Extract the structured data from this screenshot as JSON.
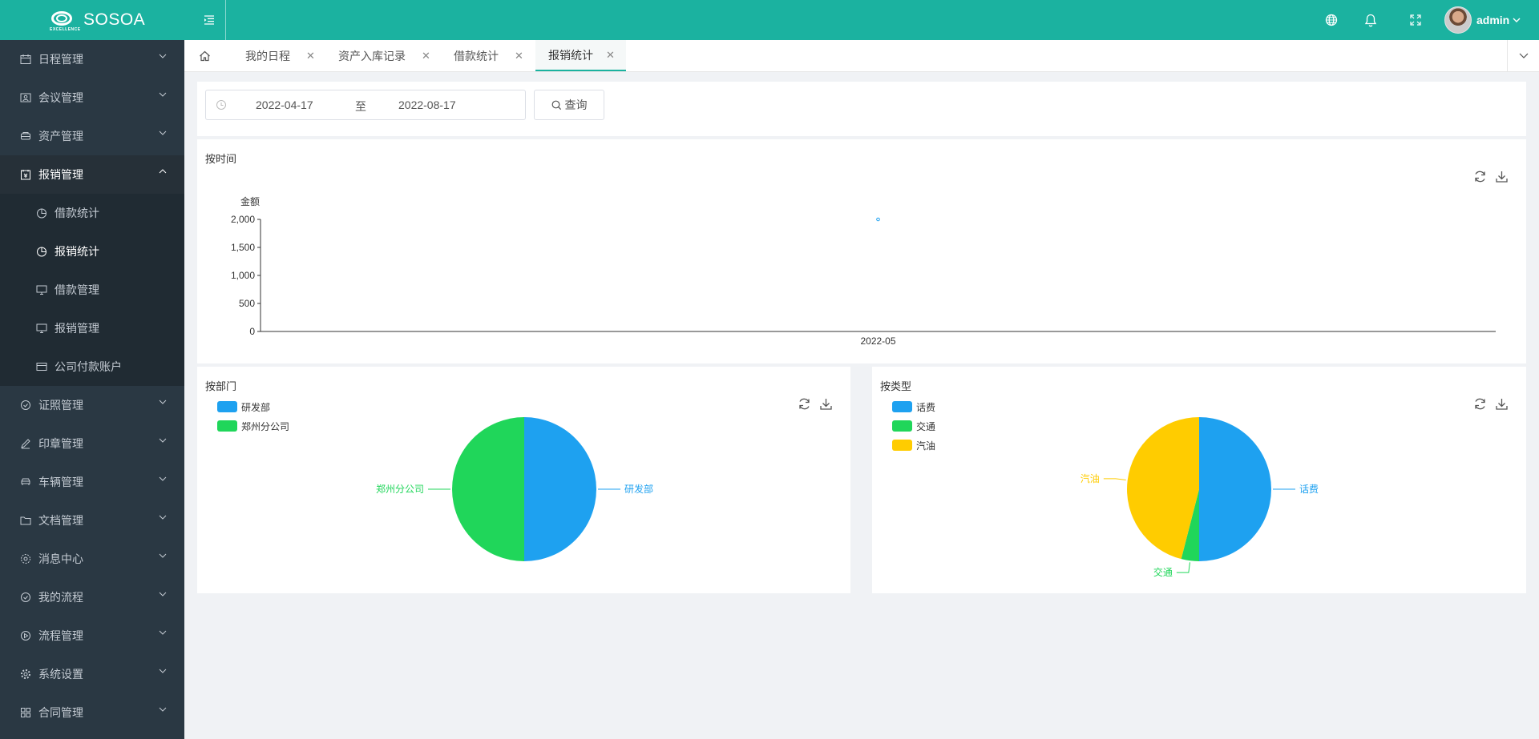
{
  "header": {
    "logo_text": "SOSOA",
    "logo_sub": "EXCELLENCE",
    "username": "admin",
    "icons": [
      "globe-icon",
      "bell-icon",
      "fullscreen-icon"
    ]
  },
  "sidebar": {
    "items": [
      {
        "label": "日程管理",
        "icon": "calendar-icon"
      },
      {
        "label": "会议管理",
        "icon": "meeting-icon"
      },
      {
        "label": "资产管理",
        "icon": "asset-icon"
      },
      {
        "label": "报销管理",
        "icon": "expense-icon",
        "open": true,
        "children": [
          {
            "label": "借款统计",
            "icon": "pie-icon"
          },
          {
            "label": "报销统计",
            "icon": "pie-icon",
            "active": true
          },
          {
            "label": "借款管理",
            "icon": "monitor-icon"
          },
          {
            "label": "报销管理",
            "icon": "monitor-icon"
          },
          {
            "label": "公司付款账户",
            "icon": "card-icon"
          }
        ]
      },
      {
        "label": "证照管理",
        "icon": "check-circle-icon"
      },
      {
        "label": "印章管理",
        "icon": "stamp-icon"
      },
      {
        "label": "车辆管理",
        "icon": "car-icon"
      },
      {
        "label": "文档管理",
        "icon": "folder-icon"
      },
      {
        "label": "消息中心",
        "icon": "settings-icon"
      },
      {
        "label": "我的流程",
        "icon": "check-circle-icon"
      },
      {
        "label": "流程管理",
        "icon": "play-circle-icon"
      },
      {
        "label": "系统设置",
        "icon": "gear-icon"
      },
      {
        "label": "合同管理",
        "icon": "grid-icon"
      }
    ]
  },
  "tabs": [
    {
      "label": "我的日程"
    },
    {
      "label": "资产入库记录"
    },
    {
      "label": "借款统计"
    },
    {
      "label": "报销统计",
      "active": true
    }
  ],
  "filter": {
    "start_date": "2022-04-17",
    "separator": "至",
    "end_date": "2022-08-17",
    "query_label": "查询"
  },
  "time_panel": {
    "title": "按时间"
  },
  "dept_panel": {
    "title": "按部门"
  },
  "type_panel": {
    "title": "按类型"
  },
  "colors": {
    "primary": "#1bb2a0",
    "blue": "#1ea1f0",
    "green": "#20d65a",
    "yellow": "#ffcc00"
  },
  "chart_data": [
    {
      "type": "scatter",
      "ylabel": "金额",
      "x": [
        "2022-05"
      ],
      "y_ticks": [
        0,
        500,
        1000,
        1500,
        2000
      ],
      "ylim": [
        0,
        2000
      ],
      "series": [
        {
          "values": [
            2000
          ]
        }
      ],
      "grid": false
    },
    {
      "type": "pie",
      "categories": [
        "研发部",
        "郑州分公司"
      ],
      "values": [
        50,
        50
      ],
      "colors": [
        "#1ea1f0",
        "#20d65a"
      ],
      "legend": "top-left"
    },
    {
      "type": "pie",
      "categories": [
        "话费",
        "交通",
        "汽油"
      ],
      "values": [
        50,
        4,
        46
      ],
      "colors": [
        "#1ea1f0",
        "#20d65a",
        "#ffcc00"
      ],
      "legend": "top-left"
    }
  ]
}
